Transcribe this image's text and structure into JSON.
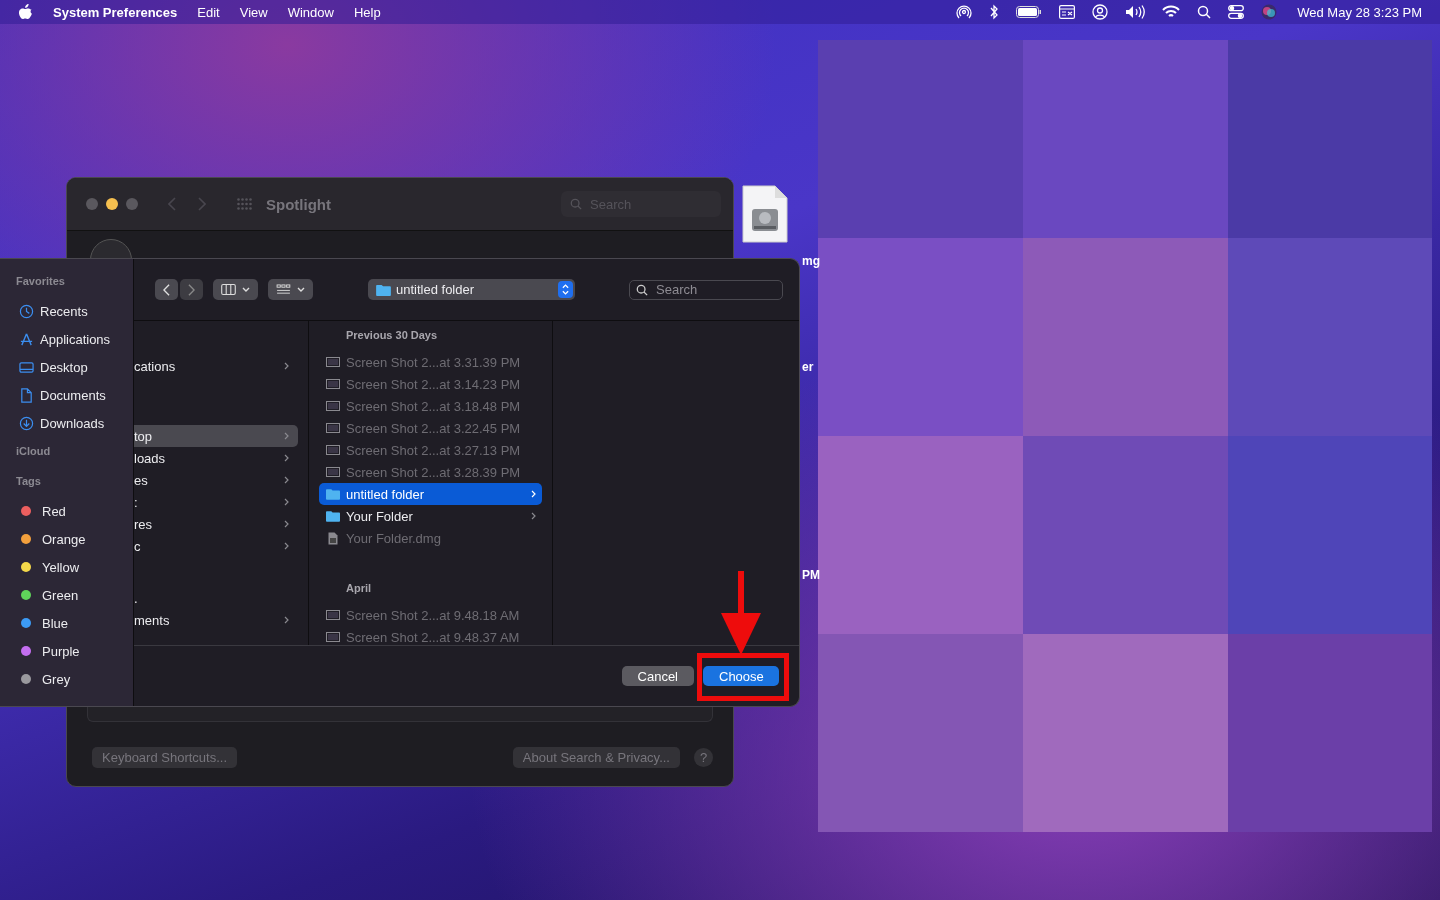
{
  "menu_bar": {
    "app_name": "System Preferences",
    "menus": [
      "Edit",
      "View",
      "Window",
      "Help"
    ],
    "clock": "Wed May 28  3:23 PM"
  },
  "desktop_labels": [
    "mg",
    "er",
    "PM"
  ],
  "spotlight_window": {
    "title": "Spotlight",
    "search": {
      "placeholder": "Search"
    },
    "buttons": [
      "Keyboard Shortcuts...",
      "About Search & Privacy..."
    ],
    "help": "?"
  },
  "dialog": {
    "sidebar": [
      {
        "title": "Favorites",
        "items": [
          {
            "label": "Recents",
            "kind": "recents"
          },
          {
            "label": "Applications",
            "kind": "applications"
          },
          {
            "label": "Desktop",
            "kind": "desktop"
          },
          {
            "label": "Documents",
            "kind": "documents"
          },
          {
            "label": "Downloads",
            "kind": "downloads"
          }
        ]
      },
      {
        "title": "iCloud"
      },
      {
        "title": "Tags",
        "items": [
          {
            "label": "Red",
            "kind": "tag",
            "color": "#ec5f5f"
          },
          {
            "label": "Orange",
            "kind": "tag",
            "color": "#f3a03d"
          },
          {
            "label": "Yellow",
            "kind": "tag",
            "color": "#f5d94a"
          },
          {
            "label": "Green",
            "kind": "tag",
            "color": "#5fd35a"
          },
          {
            "label": "Blue",
            "kind": "tag",
            "color": "#3c9bf5"
          },
          {
            "label": "Purple",
            "kind": "tag",
            "color": "#c46ef0"
          },
          {
            "label": "Grey",
            "kind": "tag",
            "color": "#9a999e"
          }
        ]
      }
    ],
    "location": "untitled folder",
    "search": {
      "placeholder": "Search"
    },
    "column_1": [
      [
        {
          "label": "cations",
          "selected": false,
          "chevron": true
        }
      ],
      [
        {
          "label": "top",
          "selected": true,
          "chevron": true
        },
        {
          "label": "loads",
          "selected": false,
          "chevron": true
        },
        {
          "label": "es",
          "selected": false,
          "chevron": true
        },
        {
          "label": ":",
          "selected": false,
          "chevron": true
        },
        {
          "label": "res",
          "selected": false,
          "chevron": true
        },
        {
          "label": "c",
          "selected": false,
          "chevron": true
        }
      ],
      [
        {
          "label": ".",
          "selected": false,
          "chevron": false
        },
        {
          "label": "ments",
          "selected": false,
          "chevron": true
        }
      ]
    ],
    "column_2": [
      {
        "title": "Previous 30 Days",
        "items": [
          {
            "label": "Screen Shot 2...at 3.31.39 PM",
            "kind": "screenshot",
            "selected": false,
            "disabled": true
          },
          {
            "label": "Screen Shot 2...at 3.14.23 PM",
            "kind": "screenshot",
            "selected": false,
            "disabled": true
          },
          {
            "label": "Screen Shot 2...at 3.18.48 PM",
            "kind": "screenshot",
            "selected": false,
            "disabled": true
          },
          {
            "label": "Screen Shot 2...at 3.22.45 PM",
            "kind": "screenshot",
            "selected": false,
            "disabled": true
          },
          {
            "label": "Screen Shot 2...at 3.27.13 PM",
            "kind": "screenshot",
            "selected": false,
            "disabled": true
          },
          {
            "label": "Screen Shot 2...at 3.28.39 PM",
            "kind": "screenshot",
            "selected": false,
            "disabled": true
          },
          {
            "label": "untitled folder",
            "kind": "folder",
            "selected": true,
            "disabled": false
          },
          {
            "label": "Your Folder",
            "kind": "folder",
            "selected": false,
            "disabled": false
          },
          {
            "label": "Your Folder.dmg",
            "kind": "dmg",
            "selected": false,
            "disabled": true
          }
        ]
      },
      {
        "title": "April",
        "items": [
          {
            "label": "Screen Shot 2...at 9.48.18 AM",
            "kind": "screenshot",
            "selected": false,
            "disabled": true
          },
          {
            "label": "Screen Shot 2...at 9.48.37 AM",
            "kind": "screenshot",
            "selected": false,
            "disabled": true
          }
        ]
      }
    ],
    "buttons": [
      {
        "label": "Cancel",
        "kind": "secondary"
      },
      {
        "label": "Choose",
        "kind": "primary"
      }
    ]
  }
}
